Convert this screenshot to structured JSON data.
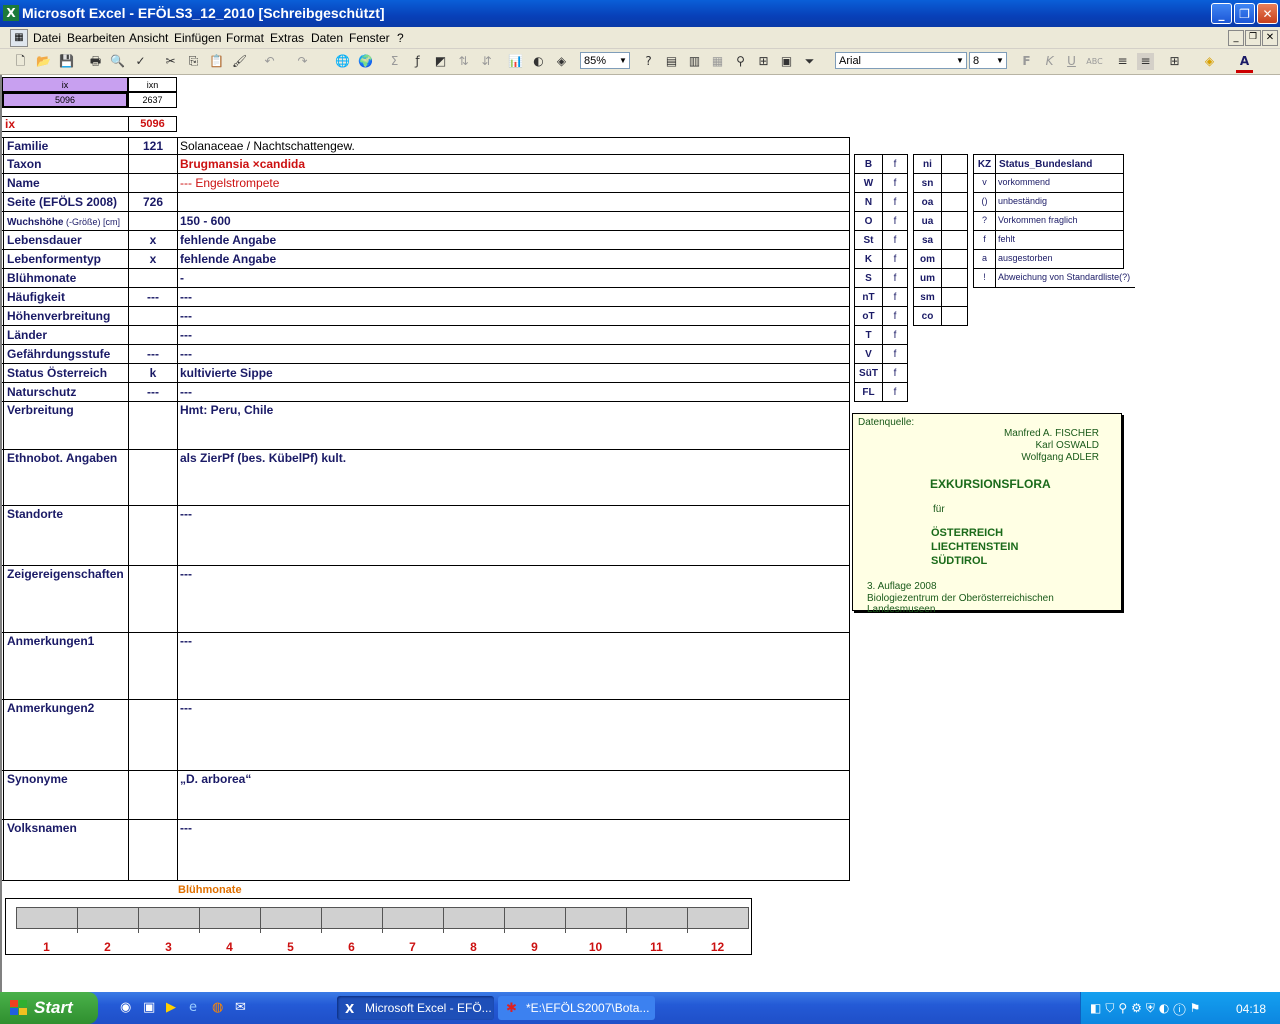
{
  "window": {
    "title": "Microsoft Excel - EFÖLS3_12_2010  [Schreibgeschützt]"
  },
  "menu": [
    "Datei",
    "Bearbeiten",
    "Ansicht",
    "Einfügen",
    "Format",
    "Extras",
    "Daten",
    "Fenster",
    "?"
  ],
  "toolbar": {
    "zoom": "85%",
    "font": "Arial",
    "size": "8"
  },
  "top": {
    "ix_h": "ix",
    "ixn_h": "ixn",
    "ix_v": "5096",
    "ixn_v": "2637",
    "ix_label": "ix",
    "ix_value": "5096"
  },
  "rows": [
    {
      "label": "Familie",
      "code": "121",
      "value": "Solanaceae  /  Nachtschattengew."
    },
    {
      "label": "Taxon",
      "code": "",
      "value": "Brugmansia ×candida"
    },
    {
      "label": "Name",
      "code": "",
      "value": "--- Engelstrompete"
    },
    {
      "label": "Seite (EFÖLS 2008)",
      "code": "726",
      "value": ""
    },
    {
      "label": "Wuchshöhe",
      "label_suffix": " (-Größe) [cm]",
      "code": "",
      "value": " 150 - 600"
    },
    {
      "label": "Lebensdauer",
      "code": "x",
      "value": "fehlende Angabe"
    },
    {
      "label": "Lebenformentyp",
      "code": "x",
      "value": "fehlende Angabe"
    },
    {
      "label": "Blühmonate",
      "code": "",
      "value": " -"
    },
    {
      "label": "Häufigkeit",
      "code": "---",
      "value": " ---"
    },
    {
      "label": "Höhenverbreitung",
      "code": "",
      "value": " ---"
    },
    {
      "label": "Länder",
      "code": "",
      "value": " ---"
    },
    {
      "label": "Gefährdungsstufe",
      "code": "---",
      "value": "   ---"
    },
    {
      "label": "Status Österreich",
      "code": "k",
      "value": "kultivierte Sippe"
    },
    {
      "label": "Naturschutz",
      "code": "---",
      "value": " ---"
    },
    {
      "label": "Verbreitung",
      "code": "",
      "value": "Hmt: Peru, Chile"
    },
    {
      "label": "Ethnobot. Angaben",
      "code": "",
      "value": "als ZierPf (bes. KübelPf)  kult."
    },
    {
      "label": "Standorte",
      "code": "",
      "value": "---"
    },
    {
      "label": "Zeigereigenschaften",
      "code": "",
      "value": "---"
    },
    {
      "label": "Anmerkungen1",
      "code": "",
      "value": "---"
    },
    {
      "label": "Anmerkungen2",
      "code": "",
      "value": "---"
    },
    {
      "label": "Synonyme",
      "code": "",
      "value": "„D. arborea“"
    },
    {
      "label": "Volksnamen",
      "code": "",
      "value": "---"
    }
  ],
  "regions1": [
    {
      "code": "B",
      "v": "f"
    },
    {
      "code": "W",
      "v": "f"
    },
    {
      "code": "N",
      "v": "f"
    },
    {
      "code": "O",
      "v": "f"
    },
    {
      "code": "St",
      "v": "f"
    },
    {
      "code": "K",
      "v": "f"
    },
    {
      "code": "S",
      "v": "f"
    },
    {
      "code": "nT",
      "v": "f"
    },
    {
      "code": "oT",
      "v": "f"
    },
    {
      "code": "T",
      "v": "f"
    },
    {
      "code": "V",
      "v": "f"
    },
    {
      "code": "SüT",
      "v": "f"
    },
    {
      "code": "FL",
      "v": "f"
    }
  ],
  "regions2": [
    "ni",
    "sn",
    "oa",
    "ua",
    "sa",
    "om",
    "um",
    "sm",
    "co"
  ],
  "status": {
    "kz_h": "KZ",
    "title": "Status_Bundesland",
    "items": [
      {
        "k": "v",
        "t": "vorkommend"
      },
      {
        "k": "()",
        "t": "unbeständig"
      },
      {
        "k": "?",
        "t": "Vorkommen fraglich"
      },
      {
        "k": "f",
        "t": "fehlt"
      },
      {
        "k": "a",
        "t": "ausgestorben"
      },
      {
        "k": "!",
        "t": "Abweichung von Standardliste(?)"
      }
    ]
  },
  "source": {
    "label": "Datenquelle:",
    "authors": [
      "Manfred A. FISCHER",
      "Karl OSWALD",
      "Wolfgang ADLER"
    ],
    "title": "EXKURSIONSFLORA",
    "fuer": "für",
    "countries": [
      "ÖSTERREICH",
      "LIECHTENSTEIN",
      "SÜDTIROL"
    ],
    "edition": "3. Auflage 2008",
    "publisher": "Biologiezentrum der Oberösterreichischen Landesmuseen"
  },
  "bloom": {
    "title": "Blühmonate",
    "months": [
      "1",
      "2",
      "3",
      "4",
      "5",
      "6",
      "7",
      "8",
      "9",
      "10",
      "11",
      "12"
    ]
  },
  "taskbar": {
    "start": "Start",
    "tasks": [
      "Microsoft Excel - EFÖ...",
      "*E:\\EFÖLS2007\\Bota..."
    ],
    "clock": "04:18"
  }
}
